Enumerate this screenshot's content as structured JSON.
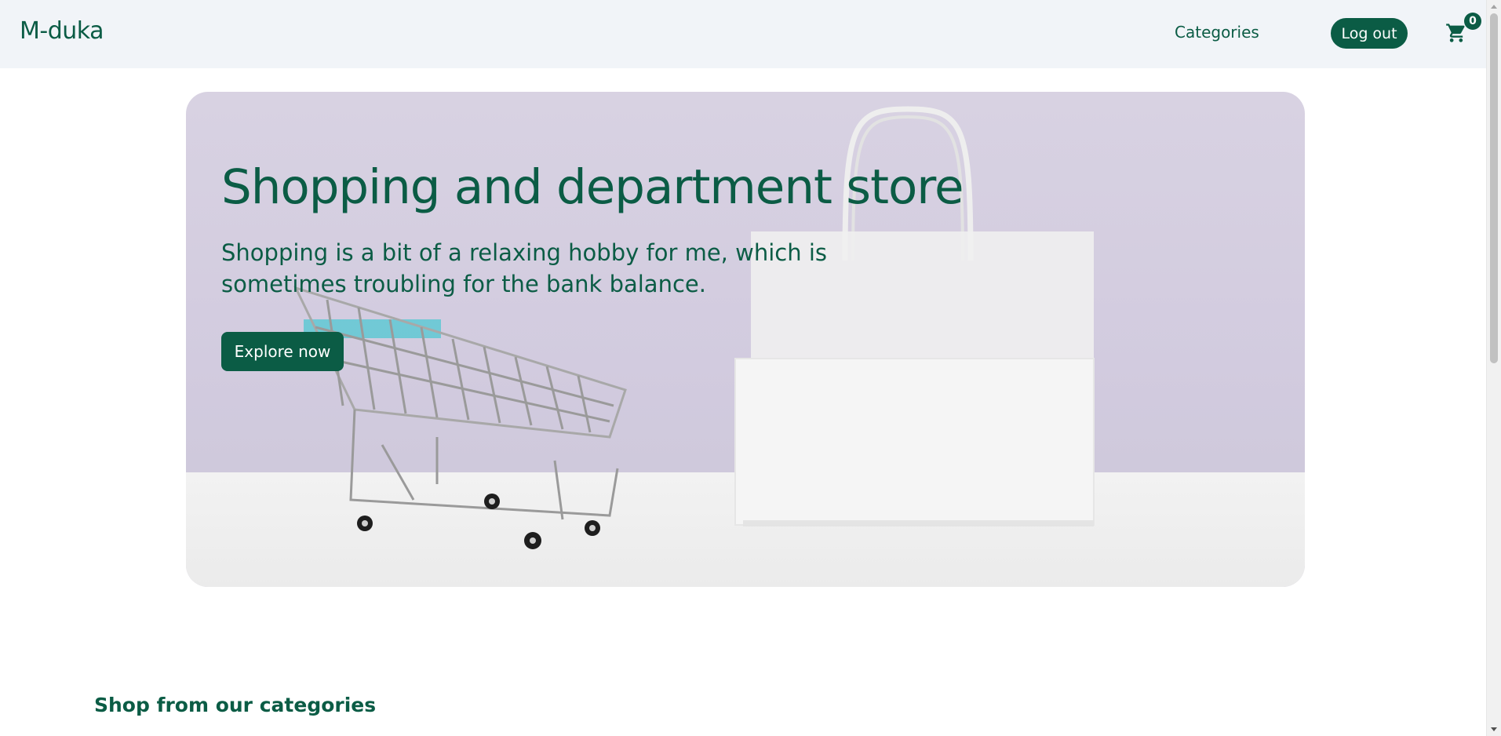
{
  "navbar": {
    "brand": "M-duka",
    "categories_link": "Categories",
    "logout_label": "Log out",
    "cart_count": "0"
  },
  "hero": {
    "title": "Shopping and department store",
    "subtitle": "Shopping is a bit of a relaxing hobby for me, which is sometimes troubling for the bank balance.",
    "cta_label": "Explore now"
  },
  "section": {
    "heading": "Shop from our categories"
  },
  "colors": {
    "brand": "#0b5c45",
    "navbar_bg": "#f1f4f8",
    "hero_bg": "#d4cee0"
  },
  "icons": {
    "cart": "shopping-cart-icon"
  }
}
